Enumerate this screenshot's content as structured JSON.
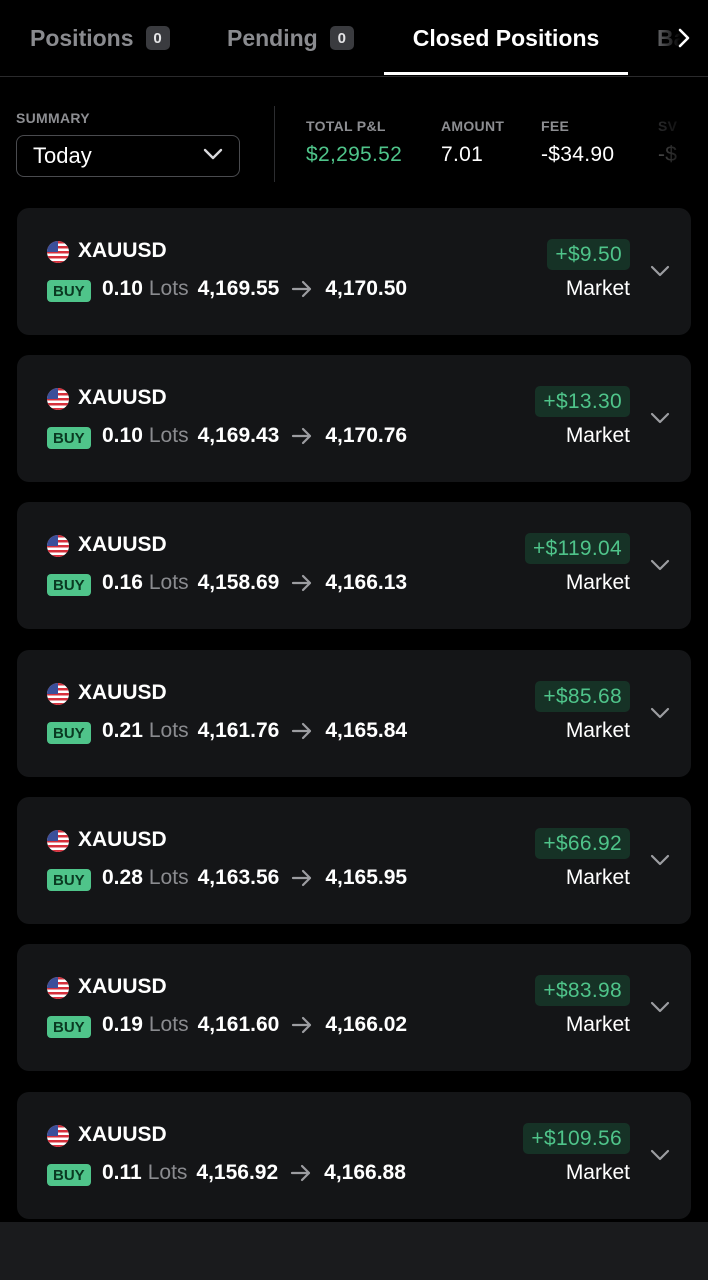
{
  "tabs": [
    {
      "label": "Positions",
      "badge": "0"
    },
    {
      "label": "Pending",
      "badge": "0"
    },
    {
      "label": "Closed Positions"
    },
    {
      "label": "Ba"
    }
  ],
  "summary": {
    "label": "SUMMARY",
    "period": "Today",
    "stats": {
      "total_pnl": {
        "label": "TOTAL P&L",
        "value": "$2,295.52"
      },
      "amount": {
        "label": "AMOUNT",
        "value": "7.01"
      },
      "fee": {
        "label": "FEE",
        "value": "-$34.90"
      },
      "swap": {
        "label": "SV",
        "value": "-$"
      }
    }
  },
  "positions": [
    {
      "symbol": "XAUUSD",
      "side": "BUY",
      "lots": "0.10",
      "lots_label": "Lots",
      "open": "4,169.55",
      "close": "4,170.50",
      "pnl": "+$9.50",
      "type": "Market"
    },
    {
      "symbol": "XAUUSD",
      "side": "BUY",
      "lots": "0.10",
      "lots_label": "Lots",
      "open": "4,169.43",
      "close": "4,170.76",
      "pnl": "+$13.30",
      "type": "Market"
    },
    {
      "symbol": "XAUUSD",
      "side": "BUY",
      "lots": "0.16",
      "lots_label": "Lots",
      "open": "4,158.69",
      "close": "4,166.13",
      "pnl": "+$119.04",
      "type": "Market"
    },
    {
      "symbol": "XAUUSD",
      "side": "BUY",
      "lots": "0.21",
      "lots_label": "Lots",
      "open": "4,161.76",
      "close": "4,165.84",
      "pnl": "+$85.68",
      "type": "Market"
    },
    {
      "symbol": "XAUUSD",
      "side": "BUY",
      "lots": "0.28",
      "lots_label": "Lots",
      "open": "4,163.56",
      "close": "4,165.95",
      "pnl": "+$66.92",
      "type": "Market"
    },
    {
      "symbol": "XAUUSD",
      "side": "BUY",
      "lots": "0.19",
      "lots_label": "Lots",
      "open": "4,161.60",
      "close": "4,166.02",
      "pnl": "+$83.98",
      "type": "Market"
    },
    {
      "symbol": "XAUUSD",
      "side": "BUY",
      "lots": "0.11",
      "lots_label": "Lots",
      "open": "4,156.92",
      "close": "4,166.88",
      "pnl": "+$109.56",
      "type": "Market"
    }
  ],
  "colors": {
    "background": "#000000",
    "card": "#141517",
    "profit": "#4fc48a",
    "profit_bg": "#163226",
    "muted": "#8a8b8f"
  },
  "icons": [
    "chevron-right-icon",
    "chevron-down-icon",
    "us-flag-icon",
    "arrow-right-icon"
  ]
}
